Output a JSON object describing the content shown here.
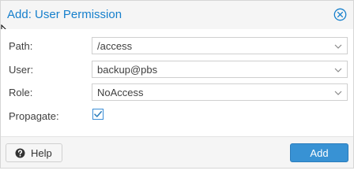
{
  "dialog": {
    "title": "Add: User Permission",
    "close_icon": "close-circle-icon"
  },
  "form": {
    "path": {
      "label": "Path:",
      "value": "/access"
    },
    "user": {
      "label": "User:",
      "value": "backup@pbs"
    },
    "role": {
      "label": "Role:",
      "value": "NoAccess"
    },
    "propagate": {
      "label": "Propagate:",
      "checked": true
    }
  },
  "footer": {
    "help_label": "Help",
    "help_icon": "question-circle-icon",
    "add_label": "Add"
  },
  "colors": {
    "title": "#157fcc",
    "primary_button": "#3892d4",
    "checkbox_border": "#3a8dd6"
  }
}
